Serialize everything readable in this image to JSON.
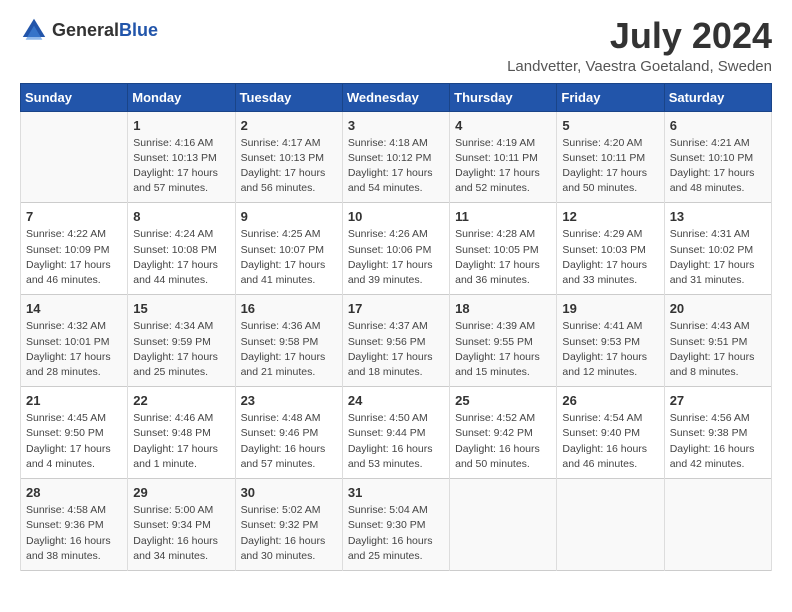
{
  "logo": {
    "general": "General",
    "blue": "Blue"
  },
  "title": "July 2024",
  "subtitle": "Landvetter, Vaestra Goetaland, Sweden",
  "headers": [
    "Sunday",
    "Monday",
    "Tuesday",
    "Wednesday",
    "Thursday",
    "Friday",
    "Saturday"
  ],
  "weeks": [
    [
      {
        "day": "",
        "info": ""
      },
      {
        "day": "1",
        "info": "Sunrise: 4:16 AM\nSunset: 10:13 PM\nDaylight: 17 hours\nand 57 minutes."
      },
      {
        "day": "2",
        "info": "Sunrise: 4:17 AM\nSunset: 10:13 PM\nDaylight: 17 hours\nand 56 minutes."
      },
      {
        "day": "3",
        "info": "Sunrise: 4:18 AM\nSunset: 10:12 PM\nDaylight: 17 hours\nand 54 minutes."
      },
      {
        "day": "4",
        "info": "Sunrise: 4:19 AM\nSunset: 10:11 PM\nDaylight: 17 hours\nand 52 minutes."
      },
      {
        "day": "5",
        "info": "Sunrise: 4:20 AM\nSunset: 10:11 PM\nDaylight: 17 hours\nand 50 minutes."
      },
      {
        "day": "6",
        "info": "Sunrise: 4:21 AM\nSunset: 10:10 PM\nDaylight: 17 hours\nand 48 minutes."
      }
    ],
    [
      {
        "day": "7",
        "info": "Sunrise: 4:22 AM\nSunset: 10:09 PM\nDaylight: 17 hours\nand 46 minutes."
      },
      {
        "day": "8",
        "info": "Sunrise: 4:24 AM\nSunset: 10:08 PM\nDaylight: 17 hours\nand 44 minutes."
      },
      {
        "day": "9",
        "info": "Sunrise: 4:25 AM\nSunset: 10:07 PM\nDaylight: 17 hours\nand 41 minutes."
      },
      {
        "day": "10",
        "info": "Sunrise: 4:26 AM\nSunset: 10:06 PM\nDaylight: 17 hours\nand 39 minutes."
      },
      {
        "day": "11",
        "info": "Sunrise: 4:28 AM\nSunset: 10:05 PM\nDaylight: 17 hours\nand 36 minutes."
      },
      {
        "day": "12",
        "info": "Sunrise: 4:29 AM\nSunset: 10:03 PM\nDaylight: 17 hours\nand 33 minutes."
      },
      {
        "day": "13",
        "info": "Sunrise: 4:31 AM\nSunset: 10:02 PM\nDaylight: 17 hours\nand 31 minutes."
      }
    ],
    [
      {
        "day": "14",
        "info": "Sunrise: 4:32 AM\nSunset: 10:01 PM\nDaylight: 17 hours\nand 28 minutes."
      },
      {
        "day": "15",
        "info": "Sunrise: 4:34 AM\nSunset: 9:59 PM\nDaylight: 17 hours\nand 25 minutes."
      },
      {
        "day": "16",
        "info": "Sunrise: 4:36 AM\nSunset: 9:58 PM\nDaylight: 17 hours\nand 21 minutes."
      },
      {
        "day": "17",
        "info": "Sunrise: 4:37 AM\nSunset: 9:56 PM\nDaylight: 17 hours\nand 18 minutes."
      },
      {
        "day": "18",
        "info": "Sunrise: 4:39 AM\nSunset: 9:55 PM\nDaylight: 17 hours\nand 15 minutes."
      },
      {
        "day": "19",
        "info": "Sunrise: 4:41 AM\nSunset: 9:53 PM\nDaylight: 17 hours\nand 12 minutes."
      },
      {
        "day": "20",
        "info": "Sunrise: 4:43 AM\nSunset: 9:51 PM\nDaylight: 17 hours\nand 8 minutes."
      }
    ],
    [
      {
        "day": "21",
        "info": "Sunrise: 4:45 AM\nSunset: 9:50 PM\nDaylight: 17 hours\nand 4 minutes."
      },
      {
        "day": "22",
        "info": "Sunrise: 4:46 AM\nSunset: 9:48 PM\nDaylight: 17 hours\nand 1 minute."
      },
      {
        "day": "23",
        "info": "Sunrise: 4:48 AM\nSunset: 9:46 PM\nDaylight: 16 hours\nand 57 minutes."
      },
      {
        "day": "24",
        "info": "Sunrise: 4:50 AM\nSunset: 9:44 PM\nDaylight: 16 hours\nand 53 minutes."
      },
      {
        "day": "25",
        "info": "Sunrise: 4:52 AM\nSunset: 9:42 PM\nDaylight: 16 hours\nand 50 minutes."
      },
      {
        "day": "26",
        "info": "Sunrise: 4:54 AM\nSunset: 9:40 PM\nDaylight: 16 hours\nand 46 minutes."
      },
      {
        "day": "27",
        "info": "Sunrise: 4:56 AM\nSunset: 9:38 PM\nDaylight: 16 hours\nand 42 minutes."
      }
    ],
    [
      {
        "day": "28",
        "info": "Sunrise: 4:58 AM\nSunset: 9:36 PM\nDaylight: 16 hours\nand 38 minutes."
      },
      {
        "day": "29",
        "info": "Sunrise: 5:00 AM\nSunset: 9:34 PM\nDaylight: 16 hours\nand 34 minutes."
      },
      {
        "day": "30",
        "info": "Sunrise: 5:02 AM\nSunset: 9:32 PM\nDaylight: 16 hours\nand 30 minutes."
      },
      {
        "day": "31",
        "info": "Sunrise: 5:04 AM\nSunset: 9:30 PM\nDaylight: 16 hours\nand 25 minutes."
      },
      {
        "day": "",
        "info": ""
      },
      {
        "day": "",
        "info": ""
      },
      {
        "day": "",
        "info": ""
      }
    ]
  ]
}
